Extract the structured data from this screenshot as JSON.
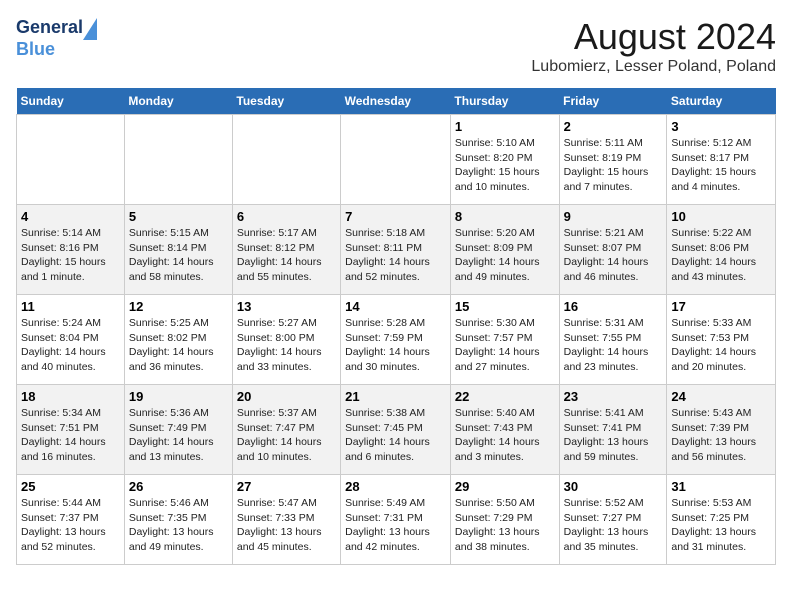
{
  "header": {
    "logo_line1": "General",
    "logo_line2": "Blue",
    "title": "August 2024",
    "subtitle": "Lubomierz, Lesser Poland, Poland"
  },
  "weekdays": [
    "Sunday",
    "Monday",
    "Tuesday",
    "Wednesday",
    "Thursday",
    "Friday",
    "Saturday"
  ],
  "weeks": [
    [
      {
        "day": "",
        "info": ""
      },
      {
        "day": "",
        "info": ""
      },
      {
        "day": "",
        "info": ""
      },
      {
        "day": "",
        "info": ""
      },
      {
        "day": "1",
        "info": "Sunrise: 5:10 AM\nSunset: 8:20 PM\nDaylight: 15 hours\nand 10 minutes."
      },
      {
        "day": "2",
        "info": "Sunrise: 5:11 AM\nSunset: 8:19 PM\nDaylight: 15 hours\nand 7 minutes."
      },
      {
        "day": "3",
        "info": "Sunrise: 5:12 AM\nSunset: 8:17 PM\nDaylight: 15 hours\nand 4 minutes."
      }
    ],
    [
      {
        "day": "4",
        "info": "Sunrise: 5:14 AM\nSunset: 8:16 PM\nDaylight: 15 hours\nand 1 minute."
      },
      {
        "day": "5",
        "info": "Sunrise: 5:15 AM\nSunset: 8:14 PM\nDaylight: 14 hours\nand 58 minutes."
      },
      {
        "day": "6",
        "info": "Sunrise: 5:17 AM\nSunset: 8:12 PM\nDaylight: 14 hours\nand 55 minutes."
      },
      {
        "day": "7",
        "info": "Sunrise: 5:18 AM\nSunset: 8:11 PM\nDaylight: 14 hours\nand 52 minutes."
      },
      {
        "day": "8",
        "info": "Sunrise: 5:20 AM\nSunset: 8:09 PM\nDaylight: 14 hours\nand 49 minutes."
      },
      {
        "day": "9",
        "info": "Sunrise: 5:21 AM\nSunset: 8:07 PM\nDaylight: 14 hours\nand 46 minutes."
      },
      {
        "day": "10",
        "info": "Sunrise: 5:22 AM\nSunset: 8:06 PM\nDaylight: 14 hours\nand 43 minutes."
      }
    ],
    [
      {
        "day": "11",
        "info": "Sunrise: 5:24 AM\nSunset: 8:04 PM\nDaylight: 14 hours\nand 40 minutes."
      },
      {
        "day": "12",
        "info": "Sunrise: 5:25 AM\nSunset: 8:02 PM\nDaylight: 14 hours\nand 36 minutes."
      },
      {
        "day": "13",
        "info": "Sunrise: 5:27 AM\nSunset: 8:00 PM\nDaylight: 14 hours\nand 33 minutes."
      },
      {
        "day": "14",
        "info": "Sunrise: 5:28 AM\nSunset: 7:59 PM\nDaylight: 14 hours\nand 30 minutes."
      },
      {
        "day": "15",
        "info": "Sunrise: 5:30 AM\nSunset: 7:57 PM\nDaylight: 14 hours\nand 27 minutes."
      },
      {
        "day": "16",
        "info": "Sunrise: 5:31 AM\nSunset: 7:55 PM\nDaylight: 14 hours\nand 23 minutes."
      },
      {
        "day": "17",
        "info": "Sunrise: 5:33 AM\nSunset: 7:53 PM\nDaylight: 14 hours\nand 20 minutes."
      }
    ],
    [
      {
        "day": "18",
        "info": "Sunrise: 5:34 AM\nSunset: 7:51 PM\nDaylight: 14 hours\nand 16 minutes."
      },
      {
        "day": "19",
        "info": "Sunrise: 5:36 AM\nSunset: 7:49 PM\nDaylight: 14 hours\nand 13 minutes."
      },
      {
        "day": "20",
        "info": "Sunrise: 5:37 AM\nSunset: 7:47 PM\nDaylight: 14 hours\nand 10 minutes."
      },
      {
        "day": "21",
        "info": "Sunrise: 5:38 AM\nSunset: 7:45 PM\nDaylight: 14 hours\nand 6 minutes."
      },
      {
        "day": "22",
        "info": "Sunrise: 5:40 AM\nSunset: 7:43 PM\nDaylight: 14 hours\nand 3 minutes."
      },
      {
        "day": "23",
        "info": "Sunrise: 5:41 AM\nSunset: 7:41 PM\nDaylight: 13 hours\nand 59 minutes."
      },
      {
        "day": "24",
        "info": "Sunrise: 5:43 AM\nSunset: 7:39 PM\nDaylight: 13 hours\nand 56 minutes."
      }
    ],
    [
      {
        "day": "25",
        "info": "Sunrise: 5:44 AM\nSunset: 7:37 PM\nDaylight: 13 hours\nand 52 minutes."
      },
      {
        "day": "26",
        "info": "Sunrise: 5:46 AM\nSunset: 7:35 PM\nDaylight: 13 hours\nand 49 minutes."
      },
      {
        "day": "27",
        "info": "Sunrise: 5:47 AM\nSunset: 7:33 PM\nDaylight: 13 hours\nand 45 minutes."
      },
      {
        "day": "28",
        "info": "Sunrise: 5:49 AM\nSunset: 7:31 PM\nDaylight: 13 hours\nand 42 minutes."
      },
      {
        "day": "29",
        "info": "Sunrise: 5:50 AM\nSunset: 7:29 PM\nDaylight: 13 hours\nand 38 minutes."
      },
      {
        "day": "30",
        "info": "Sunrise: 5:52 AM\nSunset: 7:27 PM\nDaylight: 13 hours\nand 35 minutes."
      },
      {
        "day": "31",
        "info": "Sunrise: 5:53 AM\nSunset: 7:25 PM\nDaylight: 13 hours\nand 31 minutes."
      }
    ]
  ]
}
